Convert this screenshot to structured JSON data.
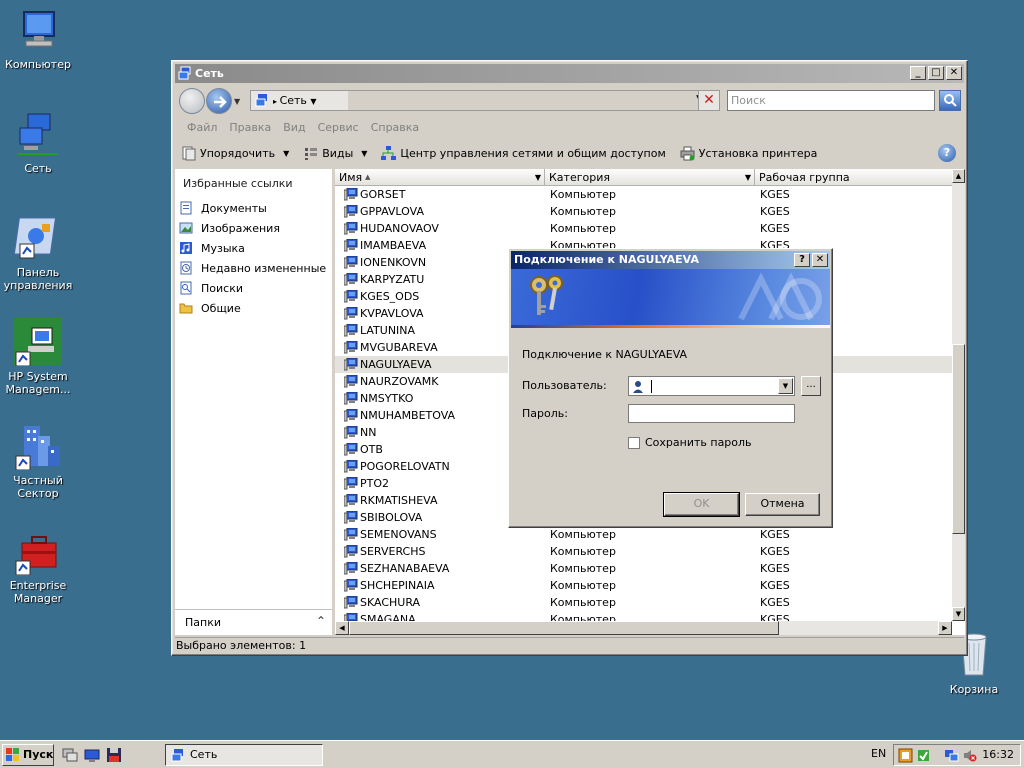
{
  "desktop": {
    "icons": [
      {
        "label": "Компьютер"
      },
      {
        "label": "Сеть"
      },
      {
        "label": "Панель управления"
      },
      {
        "label": "HP System Managem..."
      },
      {
        "label": "Частный Сектор"
      },
      {
        "label": "Enterprise Manager"
      },
      {
        "label": "Корзина"
      }
    ]
  },
  "window": {
    "title": "Сеть",
    "address": {
      "segment": "Сеть",
      "search_placeholder": "Поиск"
    },
    "menu": [
      "Файл",
      "Правка",
      "Вид",
      "Сервис",
      "Справка"
    ],
    "commands": {
      "organize": "Упорядочить",
      "views": "Виды",
      "network_center": "Центр управления сетями и общим доступом",
      "add_printer": "Установка принтера"
    },
    "left_pane": {
      "title": "Избранные ссылки",
      "items": [
        "Документы",
        "Изображения",
        "Музыка",
        "Недавно измененные",
        "Поиски",
        "Общие"
      ],
      "folders_label": "Папки"
    },
    "columns": [
      "Имя",
      "Категория",
      "Рабочая группа"
    ],
    "rows": [
      {
        "name": "GORSET",
        "category": "Компьютер",
        "group": "KGES"
      },
      {
        "name": "GPPAVLOVA",
        "category": "Компьютер",
        "group": "KGES"
      },
      {
        "name": "HUDANOVAOV",
        "category": "Компьютер",
        "group": "KGES"
      },
      {
        "name": "IMAMBAEVA",
        "category": "Компьютер",
        "group": "KGES"
      },
      {
        "name": "IONENKOVN",
        "category": "",
        "group": ""
      },
      {
        "name": "KARPYZATU",
        "category": "",
        "group": ""
      },
      {
        "name": "KGES_ODS",
        "category": "",
        "group": ""
      },
      {
        "name": "KVPAVLOVA",
        "category": "",
        "group": ""
      },
      {
        "name": "LATUNINA",
        "category": "",
        "group": ""
      },
      {
        "name": "MVGUBAREVA",
        "category": "",
        "group": ""
      },
      {
        "name": "NAGULYAEVA",
        "category": "",
        "group": ""
      },
      {
        "name": "NAURZOVAMK",
        "category": "",
        "group": ""
      },
      {
        "name": "NMSYTKO",
        "category": "",
        "group": ""
      },
      {
        "name": "NMUHAMBETOVA",
        "category": "",
        "group": ""
      },
      {
        "name": "NN",
        "category": "",
        "group": ""
      },
      {
        "name": "OTB",
        "category": "",
        "group": ""
      },
      {
        "name": "POGORELOVATN",
        "category": "",
        "group": ""
      },
      {
        "name": "PTO2",
        "category": "",
        "group": ""
      },
      {
        "name": "RKMATISHEVA",
        "category": "",
        "group": ""
      },
      {
        "name": "SBIBOLOVA",
        "category": "",
        "group": ""
      },
      {
        "name": "SEMENOVANS",
        "category": "Компьютер",
        "group": "KGES"
      },
      {
        "name": "SERVERCHS",
        "category": "Компьютер",
        "group": "KGES"
      },
      {
        "name": "SEZHANABAEVA",
        "category": "Компьютер",
        "group": "KGES"
      },
      {
        "name": "SHCHEPINAIA",
        "category": "Компьютер",
        "group": "KGES"
      },
      {
        "name": "SKACHURA",
        "category": "Компьютер",
        "group": "KGES"
      },
      {
        "name": "SMAGANA",
        "category": "Компьютер",
        "group": "KGES"
      }
    ],
    "selected_row": "NAGULYAEVA",
    "status": "Выбрано элементов: 1"
  },
  "dialog": {
    "title": "Подключение к NAGULYAEVA",
    "message": "Подключение к NAGULYAEVA",
    "user_label": "Пользователь:",
    "password_label": "Пароль:",
    "remember_label": "Сохранить пароль",
    "ok": "OK",
    "cancel": "Отмена",
    "browse": "..."
  },
  "taskbar": {
    "start": "Пуск",
    "task_title": "Сеть",
    "lang": "EN",
    "clock": "16:32"
  },
  "colors": {
    "desktop": "#3a6e8f",
    "dialog_title": "#0a246a",
    "selection": "#e4e2dc"
  }
}
